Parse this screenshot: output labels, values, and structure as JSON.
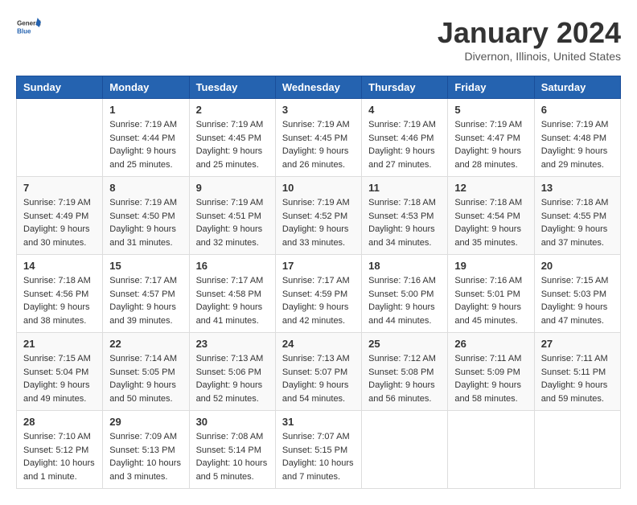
{
  "header": {
    "logo_general": "General",
    "logo_blue": "Blue",
    "title": "January 2024",
    "subtitle": "Divernon, Illinois, United States"
  },
  "weekdays": [
    "Sunday",
    "Monday",
    "Tuesday",
    "Wednesday",
    "Thursday",
    "Friday",
    "Saturday"
  ],
  "weeks": [
    [
      {
        "day": "",
        "info": ""
      },
      {
        "day": "1",
        "info": "Sunrise: 7:19 AM\nSunset: 4:44 PM\nDaylight: 9 hours\nand 25 minutes."
      },
      {
        "day": "2",
        "info": "Sunrise: 7:19 AM\nSunset: 4:45 PM\nDaylight: 9 hours\nand 25 minutes."
      },
      {
        "day": "3",
        "info": "Sunrise: 7:19 AM\nSunset: 4:45 PM\nDaylight: 9 hours\nand 26 minutes."
      },
      {
        "day": "4",
        "info": "Sunrise: 7:19 AM\nSunset: 4:46 PM\nDaylight: 9 hours\nand 27 minutes."
      },
      {
        "day": "5",
        "info": "Sunrise: 7:19 AM\nSunset: 4:47 PM\nDaylight: 9 hours\nand 28 minutes."
      },
      {
        "day": "6",
        "info": "Sunrise: 7:19 AM\nSunset: 4:48 PM\nDaylight: 9 hours\nand 29 minutes."
      }
    ],
    [
      {
        "day": "7",
        "info": "Sunrise: 7:19 AM\nSunset: 4:49 PM\nDaylight: 9 hours\nand 30 minutes."
      },
      {
        "day": "8",
        "info": "Sunrise: 7:19 AM\nSunset: 4:50 PM\nDaylight: 9 hours\nand 31 minutes."
      },
      {
        "day": "9",
        "info": "Sunrise: 7:19 AM\nSunset: 4:51 PM\nDaylight: 9 hours\nand 32 minutes."
      },
      {
        "day": "10",
        "info": "Sunrise: 7:19 AM\nSunset: 4:52 PM\nDaylight: 9 hours\nand 33 minutes."
      },
      {
        "day": "11",
        "info": "Sunrise: 7:18 AM\nSunset: 4:53 PM\nDaylight: 9 hours\nand 34 minutes."
      },
      {
        "day": "12",
        "info": "Sunrise: 7:18 AM\nSunset: 4:54 PM\nDaylight: 9 hours\nand 35 minutes."
      },
      {
        "day": "13",
        "info": "Sunrise: 7:18 AM\nSunset: 4:55 PM\nDaylight: 9 hours\nand 37 minutes."
      }
    ],
    [
      {
        "day": "14",
        "info": "Sunrise: 7:18 AM\nSunset: 4:56 PM\nDaylight: 9 hours\nand 38 minutes."
      },
      {
        "day": "15",
        "info": "Sunrise: 7:17 AM\nSunset: 4:57 PM\nDaylight: 9 hours\nand 39 minutes."
      },
      {
        "day": "16",
        "info": "Sunrise: 7:17 AM\nSunset: 4:58 PM\nDaylight: 9 hours\nand 41 minutes."
      },
      {
        "day": "17",
        "info": "Sunrise: 7:17 AM\nSunset: 4:59 PM\nDaylight: 9 hours\nand 42 minutes."
      },
      {
        "day": "18",
        "info": "Sunrise: 7:16 AM\nSunset: 5:00 PM\nDaylight: 9 hours\nand 44 minutes."
      },
      {
        "day": "19",
        "info": "Sunrise: 7:16 AM\nSunset: 5:01 PM\nDaylight: 9 hours\nand 45 minutes."
      },
      {
        "day": "20",
        "info": "Sunrise: 7:15 AM\nSunset: 5:03 PM\nDaylight: 9 hours\nand 47 minutes."
      }
    ],
    [
      {
        "day": "21",
        "info": "Sunrise: 7:15 AM\nSunset: 5:04 PM\nDaylight: 9 hours\nand 49 minutes."
      },
      {
        "day": "22",
        "info": "Sunrise: 7:14 AM\nSunset: 5:05 PM\nDaylight: 9 hours\nand 50 minutes."
      },
      {
        "day": "23",
        "info": "Sunrise: 7:13 AM\nSunset: 5:06 PM\nDaylight: 9 hours\nand 52 minutes."
      },
      {
        "day": "24",
        "info": "Sunrise: 7:13 AM\nSunset: 5:07 PM\nDaylight: 9 hours\nand 54 minutes."
      },
      {
        "day": "25",
        "info": "Sunrise: 7:12 AM\nSunset: 5:08 PM\nDaylight: 9 hours\nand 56 minutes."
      },
      {
        "day": "26",
        "info": "Sunrise: 7:11 AM\nSunset: 5:09 PM\nDaylight: 9 hours\nand 58 minutes."
      },
      {
        "day": "27",
        "info": "Sunrise: 7:11 AM\nSunset: 5:11 PM\nDaylight: 9 hours\nand 59 minutes."
      }
    ],
    [
      {
        "day": "28",
        "info": "Sunrise: 7:10 AM\nSunset: 5:12 PM\nDaylight: 10 hours\nand 1 minute."
      },
      {
        "day": "29",
        "info": "Sunrise: 7:09 AM\nSunset: 5:13 PM\nDaylight: 10 hours\nand 3 minutes."
      },
      {
        "day": "30",
        "info": "Sunrise: 7:08 AM\nSunset: 5:14 PM\nDaylight: 10 hours\nand 5 minutes."
      },
      {
        "day": "31",
        "info": "Sunrise: 7:07 AM\nSunset: 5:15 PM\nDaylight: 10 hours\nand 7 minutes."
      },
      {
        "day": "",
        "info": ""
      },
      {
        "day": "",
        "info": ""
      },
      {
        "day": "",
        "info": ""
      }
    ]
  ]
}
